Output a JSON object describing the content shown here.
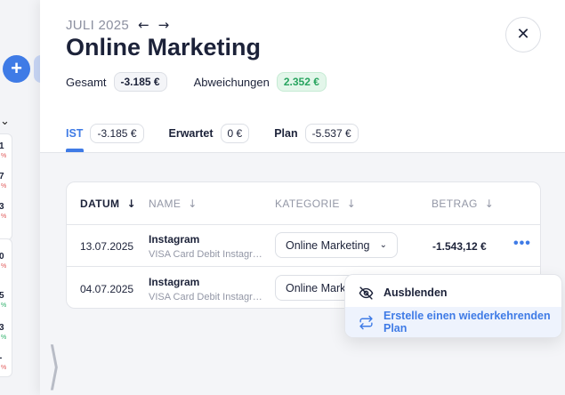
{
  "background": {
    "cards": [
      {
        "value": "1",
        "delta": "%",
        "color": "red"
      },
      {
        "value": "7",
        "delta": "%",
        "color": "red"
      },
      {
        "value": "3",
        "delta": "%",
        "color": "red"
      },
      {
        "value": "0",
        "delta": "%",
        "color": "red"
      },
      {
        "value": "5",
        "delta": "%",
        "color": "grn"
      },
      {
        "value": "3",
        "delta": "%",
        "color": "grn"
      },
      {
        "value": "-",
        "delta": "%",
        "color": "red"
      }
    ]
  },
  "header": {
    "month": "JULI 2025",
    "title": "Online Marketing",
    "close_icon": "close-icon"
  },
  "summary": {
    "total_label": "Gesamt",
    "total_value": "-3.185 €",
    "deviation_label": "Abweichungen",
    "deviation_value": "2.352 €"
  },
  "tabs": [
    {
      "label": "IST",
      "value": "-3.185 €",
      "active": true
    },
    {
      "label": "Erwartet",
      "value": "0 €",
      "active": false
    },
    {
      "label": "Plan",
      "value": "-5.537 €",
      "active": false
    }
  ],
  "table": {
    "columns": [
      "DATUM",
      "NAME",
      "KATEGORIE",
      "BETRAG"
    ],
    "rows": [
      {
        "date": "13.07.2025",
        "name": "Instagram",
        "desc": "VISA Card Debit Instagr…",
        "category": "Online Marketing",
        "amount": "-1.543,12 €"
      },
      {
        "date": "04.07.2025",
        "name": "Instagram",
        "desc": "VISA Card Debit Instagr…",
        "category": "Online Marke",
        "amount": ""
      }
    ]
  },
  "menu": {
    "hide_label": "Ausblenden",
    "recurring_label": "Erstelle einen wiederkehrenden Plan"
  },
  "colors": {
    "accent": "#3f7be6",
    "positive": "#28a45f",
    "negative": "#e05a5a"
  }
}
